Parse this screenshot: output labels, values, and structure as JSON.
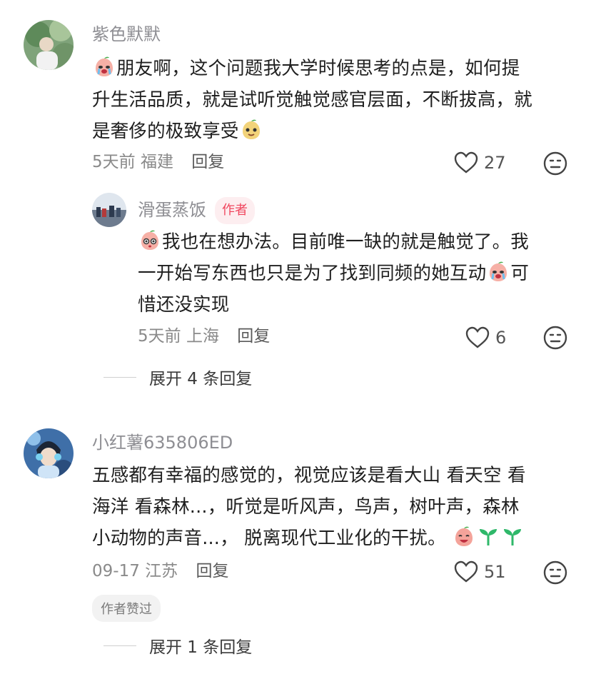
{
  "comments": [
    {
      "username": "紫色默默",
      "text_part1": "朋友啊，这个问题我大学时候思考的点是，如何提",
      "text_part2": "升生活品质，就是试听觉触觉感官层面，不断拔高，就",
      "text_part3": "是奢侈的极致享受",
      "meta_time": "5天前",
      "meta_location": "福建",
      "reply_label": "回复",
      "likes": "27",
      "emojis": [
        "crying-peach-emoji",
        "smirk-peach-emoji"
      ]
    },
    {
      "username": "滑蛋蒸饭",
      "author_badge": "作者",
      "text_part1": "我也在想办法。目前唯一缺的就是触觉了。我",
      "text_part2": "一开始写东西也只是为了找到同频的她互动",
      "text_part2b": "可",
      "text_part3": "惜还没实现",
      "meta_time": "5天前",
      "meta_location": "上海",
      "reply_label": "回复",
      "likes": "6",
      "emojis": [
        "shy-peach-emoji",
        "crying-peach-emoji"
      ]
    },
    {
      "username": "小红薯635806ED",
      "text_part1": "五感都有幸福的感觉的，视觉应该是看大山 看天空 看",
      "text_part2": "海洋 看森林...，听觉是听风声，鸟声，树叶声，森林",
      "text_part3": "小动物的声音...， 脱离现代工业化的干扰。",
      "meta_time": "09-17",
      "meta_location": "江苏",
      "reply_label": "回复",
      "likes": "51",
      "liked_chip": "作者赞过",
      "emojis": [
        "happy-peach-emoji",
        "sprout-emoji",
        "sprout-emoji"
      ]
    }
  ],
  "expand_1": "展开 4 条回复",
  "expand_2": "展开 1 条回复",
  "colors": {
    "author_badge_text": "#f0465e",
    "author_badge_bg": "#fdeef0",
    "sprout": "#2fb86a",
    "peach": "#f4a39a"
  }
}
